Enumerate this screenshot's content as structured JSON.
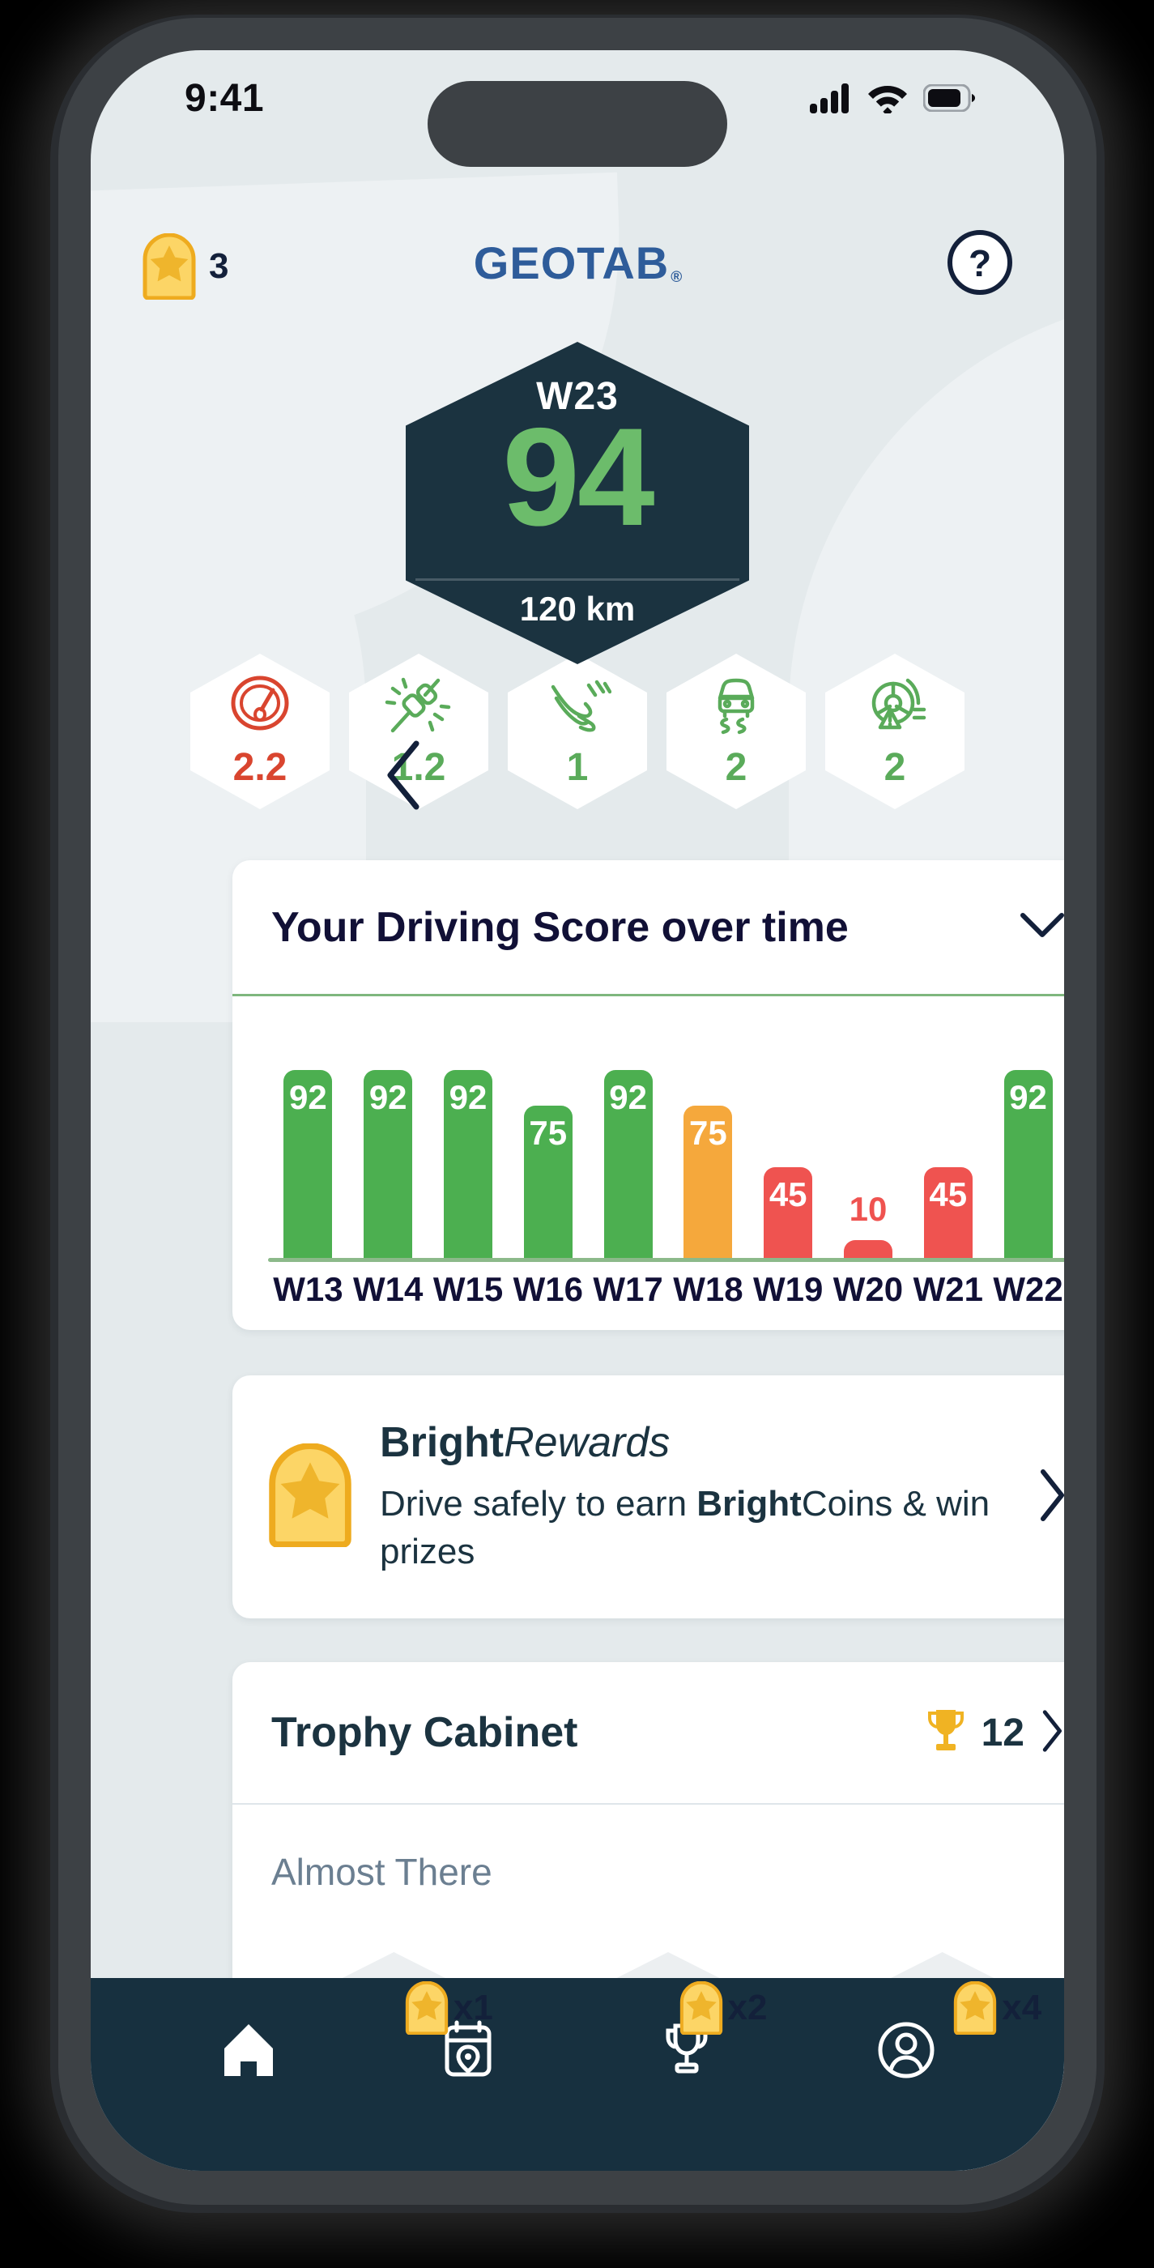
{
  "status_bar": {
    "time": "9:41",
    "icons": [
      "cellular-signal-icon",
      "wifi-icon",
      "battery-icon"
    ]
  },
  "header": {
    "coin_icon": "brightcoin-star-icon",
    "coin_count": "3",
    "logo_text": "GEOTAB",
    "logo_mark": "®",
    "help_icon": "help-question-icon"
  },
  "hero": {
    "back_icon": "chevron-left-icon",
    "week_label": "W23",
    "score": "94",
    "distance": "120 km"
  },
  "metrics": [
    {
      "icon": "speedometer-icon",
      "value": "2.2",
      "color": "#d9452f"
    },
    {
      "icon": "seatbelt-icon",
      "value": "1.2",
      "color": "#5aab5a"
    },
    {
      "icon": "harsh-pedal-icon",
      "value": "1",
      "color": "#5aab5a"
    },
    {
      "icon": "cornering-skid-icon",
      "value": "2",
      "color": "#5aab5a"
    },
    {
      "icon": "tire-warning-icon",
      "value": "2",
      "color": "#5aab5a"
    }
  ],
  "chart_card": {
    "title": "Your Driving Score over time",
    "toggle_icon": "chevron-down-icon"
  },
  "chart_data": {
    "type": "bar",
    "title": "Your Driving Score over time",
    "categories": [
      "W13",
      "W14",
      "W15",
      "W16",
      "W17",
      "W18",
      "W19",
      "W20",
      "W21",
      "W22"
    ],
    "values": [
      92,
      92,
      92,
      75,
      92,
      75,
      45,
      10,
      45,
      92
    ],
    "labels": [
      "92",
      "92",
      "92",
      "75",
      "92",
      "75",
      "45",
      "10",
      "45",
      "92"
    ],
    "colors": [
      "#4caf50",
      "#4caf50",
      "#4caf50",
      "#4caf50",
      "#4caf50",
      "#f5a83c",
      "#ef5350",
      "#ef5350",
      "#ef5350",
      "#4caf50"
    ],
    "xlabel": "",
    "ylabel": "",
    "ylim": [
      0,
      100
    ],
    "grid": false,
    "legend": false
  },
  "rewards": {
    "icon": "brightcoin-star-icon",
    "title_bold": "Bright",
    "title_italic": "Rewards",
    "sub_pre": "Drive safely to earn ",
    "sub_bold": "Bright",
    "sub_post": "Coins & win prizes",
    "chevron_icon": "chevron-right-icon"
  },
  "trophy": {
    "title": "Trophy Cabinet",
    "trophy_icon": "trophy-icon",
    "count": "12",
    "chevron_icon": "chevron-right-icon",
    "section_label": "Almost There",
    "items": [
      {
        "icon": "brightcoin-star-icon",
        "multiplier": "x1",
        "has_progress": true
      },
      {
        "icon": "brightcoin-star-icon",
        "multiplier": "x2",
        "has_progress": false
      },
      {
        "icon": "brightcoin-star-icon",
        "multiplier": "x4",
        "has_progress": false
      }
    ]
  },
  "bottom_nav": [
    {
      "icon": "home-icon",
      "active": true
    },
    {
      "icon": "trips-calendar-pin-icon",
      "active": false
    },
    {
      "icon": "trophy-outline-icon",
      "active": false
    },
    {
      "icon": "profile-account-icon",
      "active": false
    }
  ]
}
